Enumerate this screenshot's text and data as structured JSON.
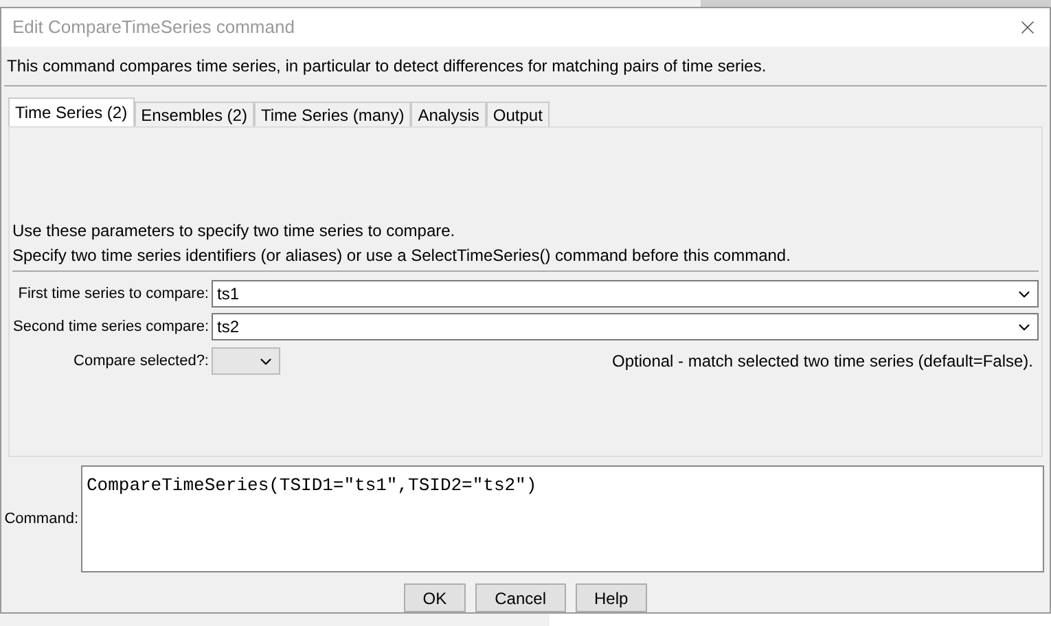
{
  "window": {
    "title": "Edit CompareTimeSeries command"
  },
  "description": "This command compares time series, in particular to detect differences for matching pairs of time series.",
  "tabs": [
    {
      "label": "Time Series (2)",
      "selected": true
    },
    {
      "label": "Ensembles (2)",
      "selected": false
    },
    {
      "label": "Time Series (many)",
      "selected": false
    },
    {
      "label": "Analysis",
      "selected": false
    },
    {
      "label": "Output",
      "selected": false
    }
  ],
  "instructions": [
    "Use these parameters to specify two time series to compare.",
    "Specify two time series identifiers (or aliases) or use a SelectTimeSeries() command before this command."
  ],
  "fields": [
    {
      "kind": "wide",
      "label": "First time series to compare:",
      "value": "ts1"
    },
    {
      "kind": "wide",
      "label": "Second time series compare:",
      "value": "ts2"
    },
    {
      "kind": "small",
      "label": "Compare selected?:",
      "note": "Optional - match selected two time series (default=False)."
    }
  ],
  "command": {
    "label": "Command:",
    "value": "CompareTimeSeries(TSID1=\"ts1\",TSID2=\"ts2\")"
  },
  "buttons": [
    "OK",
    "Cancel",
    "Help"
  ]
}
